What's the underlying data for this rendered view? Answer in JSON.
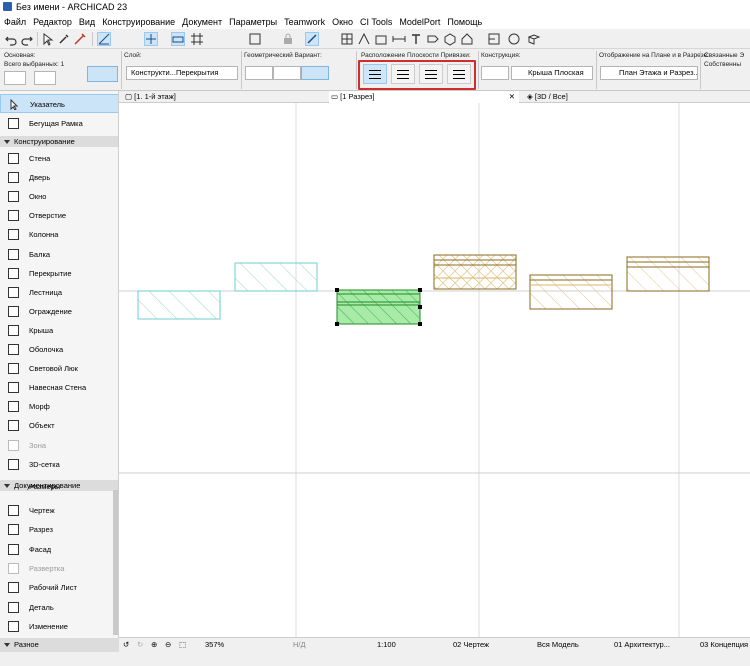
{
  "window": {
    "title": "Без имени - ARCHICAD 23"
  },
  "menu": [
    "Файл",
    "Редактор",
    "Вид",
    "Конструирование",
    "Документ",
    "Параметры",
    "Teamwork",
    "Окно",
    "CI Tools",
    "ModelPort",
    "Помощь"
  ],
  "infobox": {
    "main_label": "Основная:",
    "selected_count": "Всего выбранных: 1",
    "layer_label": "Слой:",
    "layer_value": "Конструкти...Перекрытия",
    "geometry_label": "Геометрический Вариант:",
    "anchor_label": "Расположение Плоскости Привязки:",
    "structure_label": "Конструкция:",
    "structure_value": "Крыша Плоская",
    "display_label": "Отображение на Плане и в Разрезе:",
    "display_value": "План Этажа и Разрез...",
    "linked_label": "Связанные Э",
    "own_label": "Собственны"
  },
  "tabs": [
    {
      "label": "[1. 1-й этаж]"
    },
    {
      "label": "[1 Разрез]"
    },
    {
      "label": "[3D / Все]"
    }
  ],
  "toolbox": {
    "pointer": "Указатель",
    "marquee": "Бегущая Рамка",
    "section_design": "Конструирование",
    "design_tools": [
      "Стена",
      "Дверь",
      "Окно",
      "Отверстие",
      "Колонна",
      "Балка",
      "Перекрытие",
      "Лестница",
      "Ограждение",
      "Крыша",
      "Оболочка",
      "Световой Люк",
      "Навесная Стена",
      "Морф",
      "Объект",
      "Зона",
      "3D-сетка"
    ],
    "section_docs": "Документирование",
    "partial_item": "Размеры",
    "doc_tools": [
      "Чертеж",
      "Разрез",
      "Фасад",
      "Развертка",
      "Рабочий Лист",
      "Деталь",
      "Изменение"
    ],
    "section_misc": "Разное"
  },
  "status": {
    "zoom": "357%",
    "angle": "Н/Д",
    "scale": "1:100",
    "layer_combo": "02 Чертеж",
    "model_view": "Вся Модель",
    "pen_set": "01 Архитектур...",
    "concept": "03 Концепция"
  },
  "colors": {
    "highlight_red": "#d12d2d",
    "selected_green": "#2dbd3a",
    "cyan_hatch": "#4fc3c3",
    "brown": "#8a6a1f"
  }
}
